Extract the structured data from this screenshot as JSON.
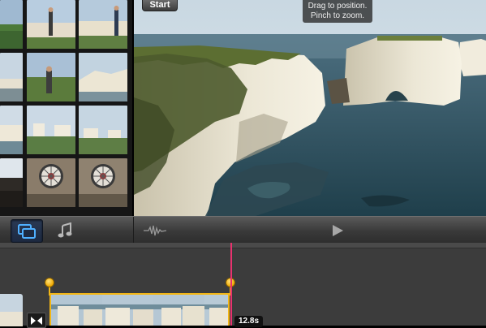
{
  "viewer": {
    "start_label": "Start",
    "hint_line1": "Drag to position.",
    "hint_line2": "Pinch to zoom."
  },
  "toolbar": {
    "items": [
      {
        "icon": "photos-video-icon",
        "active": true
      },
      {
        "icon": "music-note-icon",
        "active": false
      },
      {
        "icon": "audio-waveform-icon",
        "active": false
      },
      {
        "icon": "play-icon",
        "active": false
      }
    ]
  },
  "timeline": {
    "duration_label": "12.8s"
  },
  "colors": {
    "selection": "#f2b616",
    "playhead": "#e8326e",
    "active_button": "#2a3a55"
  }
}
